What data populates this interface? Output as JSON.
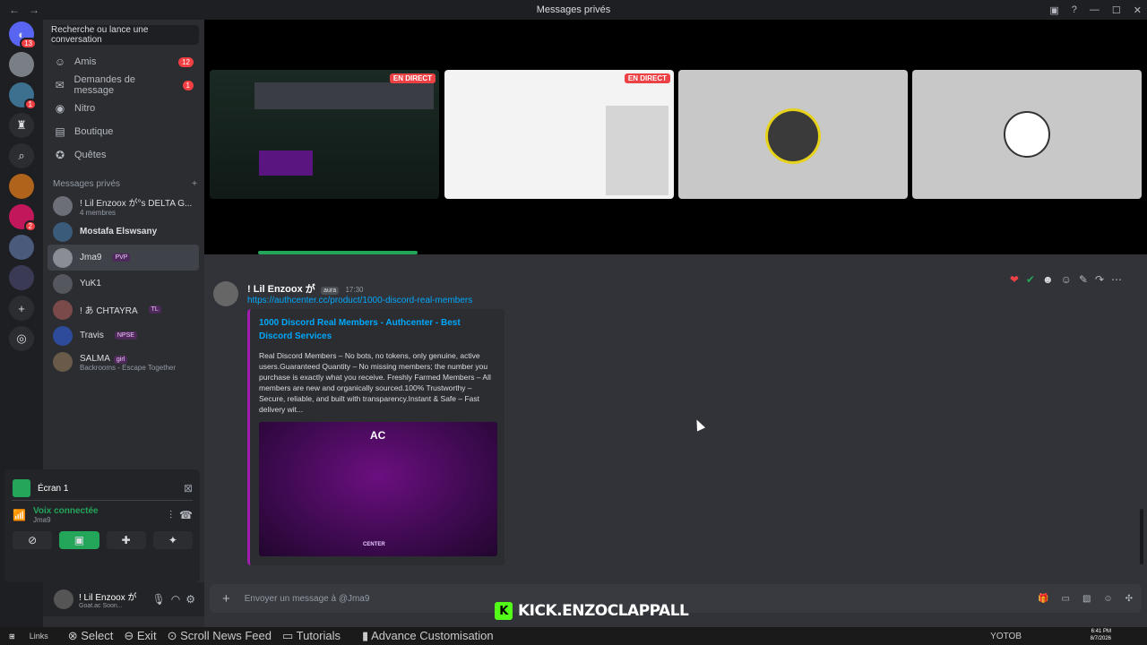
{
  "window": {
    "title": "Messages privés"
  },
  "servers": [
    {
      "icon": "discord-logo-icon",
      "badge": "13"
    },
    {
      "icon": "server-1",
      "badge": ""
    },
    {
      "icon": "server-2",
      "badge": "1"
    },
    {
      "icon": "server-3",
      "badge": ""
    },
    {
      "icon": "search-icon",
      "badge": ""
    },
    {
      "icon": "server-4",
      "badge": ""
    },
    {
      "icon": "server-5",
      "badge": "2"
    },
    {
      "icon": "server-6",
      "badge": ""
    },
    {
      "icon": "server-7",
      "badge": ""
    },
    {
      "icon": "add-server-icon",
      "badge": ""
    },
    {
      "icon": "discover-icon",
      "badge": ""
    }
  ],
  "sidebar": {
    "search_label": "Recherche ou lance une conversation",
    "nav": [
      {
        "label": "Amis",
        "badge": "12",
        "icon": "friends-icon"
      },
      {
        "label": "Demandes de message",
        "badge": "1",
        "icon": "mail-icon"
      },
      {
        "label": "Nitro",
        "badge": "",
        "icon": "nitro-icon"
      },
      {
        "label": "Boutique",
        "badge": "",
        "icon": "shop-icon"
      },
      {
        "label": "Quêtes",
        "badge": "",
        "icon": "quests-icon"
      }
    ],
    "dm_header": "Messages privés",
    "dms": [
      {
        "name": "! Lil Enzoox が°s DELTA G...",
        "sub": "4 membres",
        "tag": ""
      },
      {
        "name": "Mostafa Elswsany",
        "sub": "",
        "tag": ""
      },
      {
        "name": "Jma9",
        "sub": "",
        "tag": "PVP"
      },
      {
        "name": "YuK1",
        "sub": "",
        "tag": ""
      },
      {
        "name": "! あ CHTAYRA",
        "sub": "",
        "tag": "TL"
      },
      {
        "name": "Travis",
        "sub": "",
        "tag": "NPSE"
      },
      {
        "name": "SALMA",
        "sub": "Backrooms - Escape Together",
        "tag": "girl"
      }
    ]
  },
  "voice": {
    "screen_label": "Écran 1",
    "status": "Voix connectée",
    "channel": "Jma9"
  },
  "user": {
    "name": "! Lil Enzoox が",
    "status": "Goat.ac Soon..."
  },
  "streams": [
    {
      "live": "EN DIRECT"
    },
    {
      "live": "EN DIRECT"
    },
    {
      "live": ""
    },
    {
      "live": ""
    }
  ],
  "message": {
    "author": "! Lil Enzoox が",
    "badge": "aura",
    "time": "17:30",
    "link": "https://authcenter.cc/product/1000-discord-real-members",
    "embed_title": "1000 Discord Real Members - Authcenter - Best Discord Services",
    "embed_desc": "Real Discord Members – No bots, no tokens, only genuine, active users.Guaranteed Quantity – No missing members; the number you purchase is exactly what you receive. Freshly Farmed Members – All members are new and organically sourced.100% Trustworthy – Secure, reliable, and built with transparency.Instant & Safe – Fast delivery wit...",
    "embed_logo": "AC",
    "embed_footer": "CENTER"
  },
  "composer": {
    "placeholder": "Envoyer un message à @Jma9"
  },
  "overlay": {
    "kick": "KICK.ENZOCLAPPALL"
  },
  "taskbar": {
    "links": "Links",
    "items": [
      "Select",
      "Exit",
      "Scroll News Feed",
      "Tutorials",
      "Advance Customisation",
      "YOTOB"
    ],
    "time": "6:41 PM",
    "date": "8/7/2026"
  },
  "colors": {
    "accent": "#5865f2",
    "live": "#ed4245",
    "kick": "#53fc18",
    "danger": "#f23f43"
  }
}
